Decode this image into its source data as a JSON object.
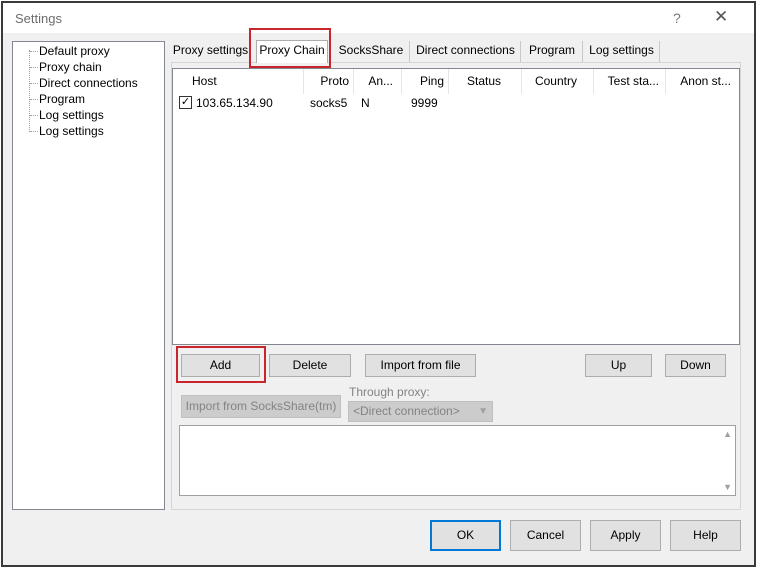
{
  "window": {
    "title": "Settings",
    "help_glyph": "?",
    "close_glyph": "✕"
  },
  "tree": {
    "items": [
      "Default proxy",
      "Proxy chain",
      "Direct connections",
      "Program",
      "Log settings",
      "Log settings"
    ]
  },
  "tabs": [
    "Proxy settings",
    "Proxy Chain",
    "SocksShare",
    "Direct connections",
    "Program",
    "Log settings"
  ],
  "list": {
    "columns": [
      "Host",
      "Proto",
      "An...",
      "Ping",
      "Status",
      "Country",
      "Test sta...",
      "Anon st..."
    ],
    "rows": [
      {
        "checked": "✓",
        "host": "103.65.134.90",
        "proto": "socks5",
        "anon": "N",
        "ping": "9999"
      }
    ]
  },
  "buttons": {
    "add": "Add",
    "delete": "Delete",
    "import_file": "Import from file",
    "up": "Up",
    "down": "Down",
    "import_socksshare": "Import from SocksShare(tm)"
  },
  "through_proxy": {
    "label": "Through proxy:",
    "value": "<Direct connection>"
  },
  "dialog": {
    "ok": "OK",
    "cancel": "Cancel",
    "apply": "Apply",
    "help": "Help"
  },
  "colors": {
    "highlight": "#c8262c",
    "default_button_border": "#0078d7"
  }
}
